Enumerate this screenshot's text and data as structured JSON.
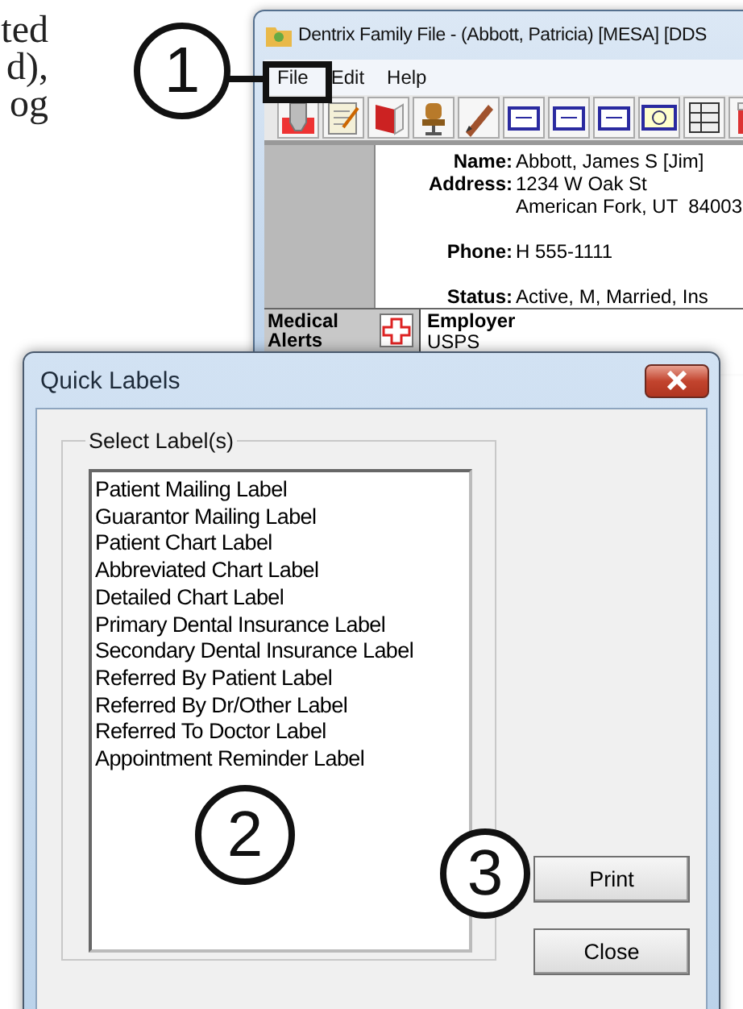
{
  "page_text": [
    "ted",
    "d),",
    "og"
  ],
  "family_window": {
    "title": "Dentrix Family File - (Abbott, Patricia) [MESA] [DDS",
    "menu": [
      "File",
      "Edit",
      "Help"
    ],
    "fields": [
      {
        "label": "Name:",
        "lines": [
          "Abbott, James S [Jim]"
        ]
      },
      {
        "label": "Address:",
        "lines": [
          "1234 W Oak St",
          "American Fork, UT  84003"
        ]
      },
      {
        "label": "Phone:",
        "lines": [
          "H 555-1111"
        ]
      },
      {
        "label": "Status:",
        "lines": [
          "Active, M, Married, Ins"
        ]
      }
    ],
    "alerts_label": "Medical Alerts",
    "employer_label": "Employer",
    "employer": "USPS"
  },
  "dialog": {
    "title": "Quick Labels",
    "group_label": "Select Label(s)",
    "items": [
      "Patient Mailing Label",
      "Guarantor Mailing Label",
      "Patient Chart Label",
      "Abbreviated Chart Label",
      "Detailed Chart Label",
      "Primary Dental Insurance Label",
      "Secondary Dental Insurance Label",
      "Referred By Patient Label",
      "Referred By Dr/Other Label",
      "Referred To Doctor Label",
      "Appointment Reminder Label"
    ],
    "buttons": [
      "Print",
      "Close"
    ]
  },
  "callouts": [
    {
      "number": "1"
    },
    {
      "number": "2"
    },
    {
      "number": "3"
    }
  ]
}
